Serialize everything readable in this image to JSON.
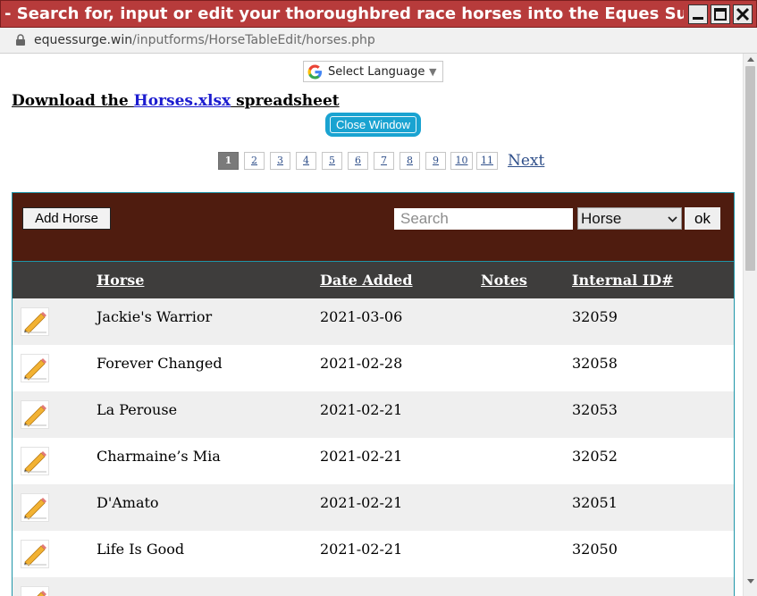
{
  "window": {
    "title": "- Search for, input or edit your thoroughbred race horses into the Eques Surge Da",
    "controls": {
      "minimize_icon": "minimize-icon",
      "maximize_icon": "maximize-icon",
      "close_icon": "close-icon"
    }
  },
  "address_bar": {
    "domain": "equessurge.win",
    "path": "/inputforms/HorseTableEdit/horses.php",
    "lock_icon": "lock-icon"
  },
  "translate": {
    "label": "Select Language",
    "caret": "▼",
    "logo_icon": "google-g-icon"
  },
  "download": {
    "prefix": "Download the ",
    "link_text": "Horses.xlsx",
    "suffix": " spreadsheet"
  },
  "close_window_label": "Close Window",
  "pagination": {
    "pages": [
      "1",
      "2",
      "3",
      "4",
      "5",
      "6",
      "7",
      "8",
      "9",
      "10",
      "11"
    ],
    "active_page": "1",
    "next_label": "Next"
  },
  "toolbar": {
    "add_label": "Add Horse",
    "search_placeholder": "Search",
    "search_value": "",
    "filter_selected": "Horse",
    "ok_label": "ok",
    "background": "#4f1c0f"
  },
  "table": {
    "columns": {
      "horse": "Horse",
      "date_added": "Date Added",
      "notes": "Notes",
      "internal_id": "Internal ID#"
    },
    "rows": [
      {
        "horse": "Jackie's Warrior",
        "date_added": "2021-03-06",
        "notes": "",
        "internal_id": "32059"
      },
      {
        "horse": "Forever Changed",
        "date_added": "2021-02-28",
        "notes": "",
        "internal_id": "32058"
      },
      {
        "horse": "La Perouse",
        "date_added": "2021-02-21",
        "notes": "",
        "internal_id": "32053"
      },
      {
        "horse": "Charmaine’s Mia",
        "date_added": "2021-02-21",
        "notes": "",
        "internal_id": "32052"
      },
      {
        "horse": "D'Amato",
        "date_added": "2021-02-21",
        "notes": "",
        "internal_id": "32051"
      },
      {
        "horse": "Life Is Good",
        "date_added": "2021-02-21",
        "notes": "",
        "internal_id": "32050"
      },
      {
        "horse": "",
        "date_added": "",
        "notes": "",
        "internal_id": ""
      }
    ],
    "edit_icon": "pencil-edit-icon",
    "row_colors": [
      "#efefef",
      "#ffffff"
    ]
  },
  "colors": {
    "titlebar": "#b73b3b",
    "header_row": "#3e3d3c",
    "accent_border": "#1e95a8",
    "close_button": "#1aa3d1",
    "link": "#1c1ccf"
  }
}
